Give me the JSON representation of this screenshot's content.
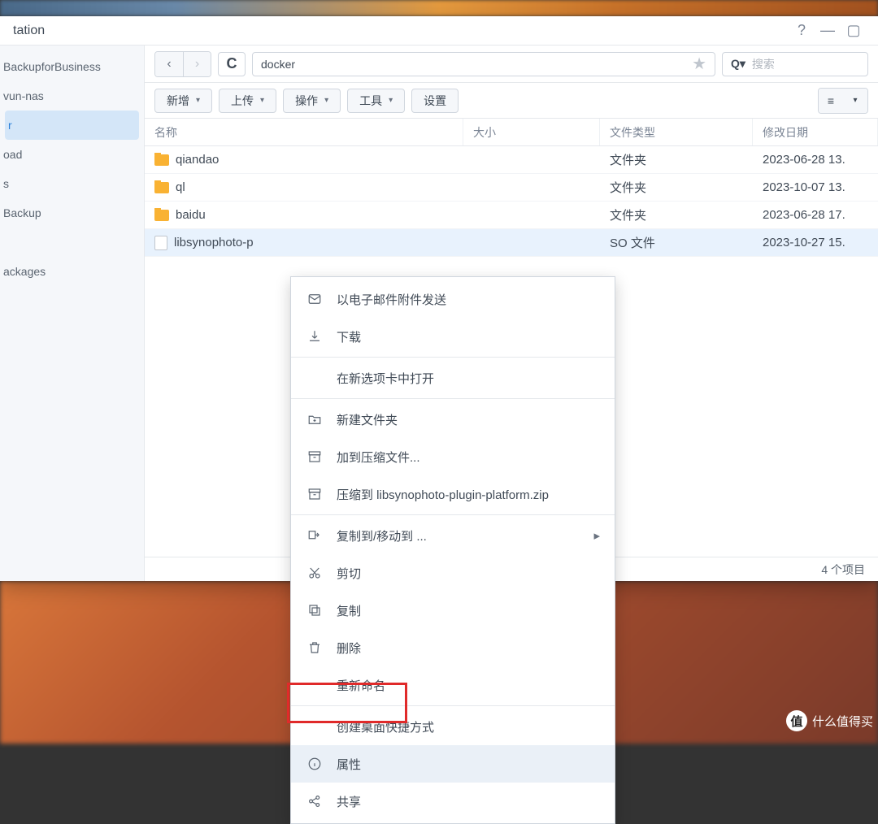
{
  "window": {
    "title": "tation"
  },
  "titlebar_icons": {
    "help": "?",
    "minimize": "—",
    "maximize": "▢"
  },
  "sidebar": {
    "items": [
      {
        "label": "BackupforBusiness",
        "selected": false
      },
      {
        "label": "vun-nas",
        "selected": false
      },
      {
        "label": "r",
        "selected": true
      },
      {
        "label": "oad",
        "selected": false
      },
      {
        "label": "s",
        "selected": false
      },
      {
        "label": "Backup",
        "selected": false
      },
      {
        "label": "",
        "selected": false
      },
      {
        "label": "ackages",
        "selected": false
      }
    ]
  },
  "path": {
    "current": "docker"
  },
  "search": {
    "placeholder": "搜索",
    "prefix": "Q▾"
  },
  "toolbar": {
    "new_btn": "新增",
    "upload_btn": "上传",
    "action_btn": "操作",
    "tool_btn": "工具",
    "settings_btn": "设置",
    "view_icon": "≡"
  },
  "columns": {
    "name": "名称",
    "size": "大小",
    "type": "文件类型",
    "date": "修改日期"
  },
  "rows": [
    {
      "name": "qiandao",
      "icon": "folder",
      "size": "",
      "type": "文件夹",
      "date": "2023-06-28 13."
    },
    {
      "name": "ql",
      "icon": "folder",
      "size": "",
      "type": "文件夹",
      "date": "2023-10-07 13."
    },
    {
      "name": "baidu",
      "icon": "folder",
      "size": "",
      "type": "文件夹",
      "date": "2023-06-28 17."
    },
    {
      "name": "libsynophoto-p",
      "icon": "file",
      "size": "",
      "type": "SO 文件",
      "date": "2023-10-27 15.",
      "selected": true
    }
  ],
  "status": {
    "count": "4 个项目"
  },
  "context_menu": [
    {
      "icon": "mail",
      "label": "以电子邮件附件发送"
    },
    {
      "icon": "download",
      "label": "下载"
    },
    {
      "sep": true
    },
    {
      "icon": "",
      "label": "在新选项卡中打开"
    },
    {
      "sep": true
    },
    {
      "icon": "newfolder",
      "label": "新建文件夹"
    },
    {
      "icon": "archive",
      "label": "加到压缩文件..."
    },
    {
      "icon": "archive",
      "label": "压缩到 libsynophoto-plugin-platform.zip"
    },
    {
      "sep": true
    },
    {
      "icon": "move",
      "label": "复制到/移动到 ...",
      "submenu": true
    },
    {
      "icon": "cut",
      "label": "剪切"
    },
    {
      "icon": "copy",
      "label": "复制"
    },
    {
      "icon": "trash",
      "label": "删除"
    },
    {
      "icon": "",
      "label": "重新命名"
    },
    {
      "sep": true
    },
    {
      "icon": "",
      "label": "创建桌面快捷方式"
    },
    {
      "icon": "info",
      "label": "属性",
      "highlight": true
    },
    {
      "icon": "share",
      "label": "共享"
    }
  ],
  "watermark": {
    "icon": "值",
    "text": "什么值得买"
  }
}
